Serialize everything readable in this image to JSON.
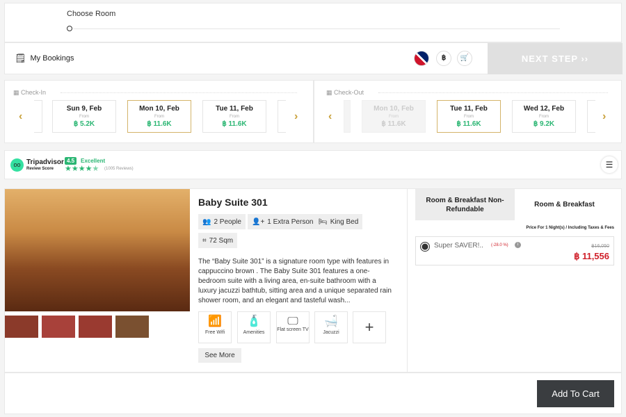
{
  "steps": {
    "title": "Choose Room"
  },
  "header": {
    "bookings_label": "My Bookings",
    "currency": "฿",
    "next_step": "NEXT STEP ››"
  },
  "checkin": {
    "label": "Check-In",
    "dates": [
      {
        "day": "Sun 9, Feb",
        "from": "From",
        "price": "฿ 5.2K"
      },
      {
        "day": "Mon 10, Feb",
        "from": "From",
        "price": "฿ 11.6K"
      },
      {
        "day": "Tue 11, Feb",
        "from": "From",
        "price": "฿ 11.6K"
      }
    ]
  },
  "checkout": {
    "label": "Check-Out",
    "dates": [
      {
        "day": "Mon 10, Feb",
        "from": "From",
        "price": "฿ 11.6K"
      },
      {
        "day": "Tue 11, Feb",
        "from": "From",
        "price": "฿ 11.6K"
      },
      {
        "day": "Wed 12, Feb",
        "from": "From",
        "price": "฿ 9.2K"
      }
    ]
  },
  "review": {
    "brand": "Tripadvisor",
    "sub": "Review Score",
    "score": "4.5",
    "rating_word": "Excellent",
    "stars": 4.5,
    "count": "(1005 Reviews)"
  },
  "room": {
    "name": "Baby Suite 301",
    "features": [
      "2 People",
      "1 Extra Person",
      "King Bed",
      "72 Sqm"
    ],
    "description": "The “Baby Suite 301” is a signature room type with features in cappuccino brown . The Baby Suite 301 features a one-bedroom suite with a living area, en-suite bathroom with a luxury jacuzzi bathtub, sitting area and a unique separated rain shower room, and an elegant and tasteful wash...",
    "amenities": [
      "Free Wifi",
      "Amenities",
      "Flat screen TV",
      "Jacuzzi"
    ],
    "more": "+",
    "see_more": "See More"
  },
  "rates": {
    "tabs": [
      "Room & Breakfast Non-Refundable",
      "Room & Breakfast"
    ],
    "note": "Price For 1 Night(s) / Including Taxes & Fees",
    "option": {
      "name": "Super SAVER!..",
      "discount": "(-28.0 %)",
      "old_price": "฿16,050",
      "price": "฿ 11,556"
    }
  },
  "cart": {
    "label": "Add To Cart"
  }
}
